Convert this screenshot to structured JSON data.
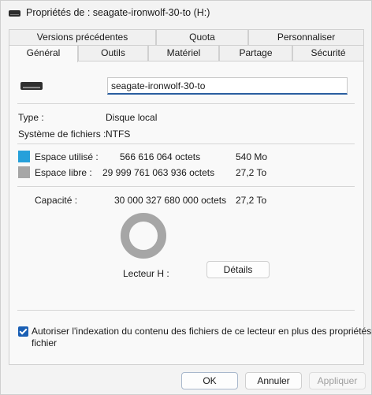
{
  "window": {
    "title": "Propriétés de : seagate-ironwolf-30-to (H:)"
  },
  "tabs": {
    "row1": [
      "Versions précédentes",
      "Quota",
      "Personnaliser"
    ],
    "row2": [
      "Général",
      "Outils",
      "Matériel",
      "Partage",
      "Sécurité"
    ],
    "active": "Général"
  },
  "general": {
    "drive_name": "seagate-ironwolf-30-to",
    "type_label": "Type :",
    "type_value": "Disque local",
    "fs_label": "Système de fichiers :",
    "fs_value": "NTFS",
    "used_label": "Espace utilisé :",
    "used_bytes": "566 616 064 octets",
    "used_size": "540 Mo",
    "free_label": "Espace libre :",
    "free_bytes": "29 999 761 063 936 octets",
    "free_size": "27,2 To",
    "capacity_label": "Capacité :",
    "capacity_bytes": "30 000 327 680 000 octets",
    "capacity_size": "27,2 To",
    "drive_letter_label": "Lecteur H :",
    "details_button": "Détails",
    "used_fraction": 1.89e-05,
    "used_color": "#26a0da",
    "free_color": "#a6a6a6",
    "index_checkbox_checked": true,
    "index_checkbox_label_line1": "Autoriser l'indexation du contenu des fichiers de ce lecteur en plus des propriétés de",
    "index_checkbox_label_line2": "fichier"
  },
  "footer": {
    "ok": "OK",
    "cancel": "Annuler",
    "apply": "Appliquer"
  }
}
